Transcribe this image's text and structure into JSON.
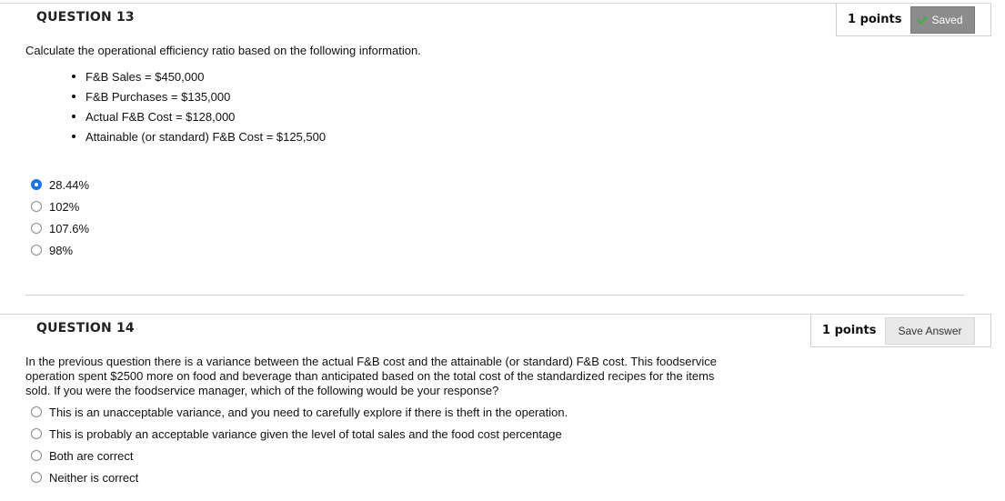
{
  "q13": {
    "title": "QUESTION 13",
    "points": "1 points",
    "status": "Saved",
    "prompt": "Calculate the operational efficiency ratio based on the following information.",
    "facts": [
      "F&B Sales = $450,000",
      "F&B Purchases = $135,000",
      "Actual F&B Cost = $128,000",
      "Attainable (or standard) F&B Cost = $125,500"
    ],
    "options": [
      "28.44%",
      "102%",
      "107.6%",
      "98%"
    ],
    "selected_index": 0
  },
  "q14": {
    "title": "QUESTION 14",
    "points": "1 points",
    "save_label": "Save Answer",
    "prompt_lines": [
      "In the previous question there is a variance between the actual F&B cost and the attainable (or standard) F&B cost. This foodservice",
      "operation spent $2500 more on food and beverage than anticipated based on the total cost of the standardized recipes for the items",
      "sold. If you were the foodservice manager, which of the following would be your response?"
    ],
    "options": [
      "This is an unacceptable variance, and you need to carefully explore if there is theft in the operation.",
      "This is probably an acceptable variance given the level of total sales and the food cost percentage",
      "Both are correct",
      "Neither is correct"
    ]
  },
  "colors": {
    "accent": "#1a73e8",
    "saved_bg": "#8c8c8c",
    "check": "#3cb043"
  },
  "icons": {
    "saved": "check-icon"
  }
}
